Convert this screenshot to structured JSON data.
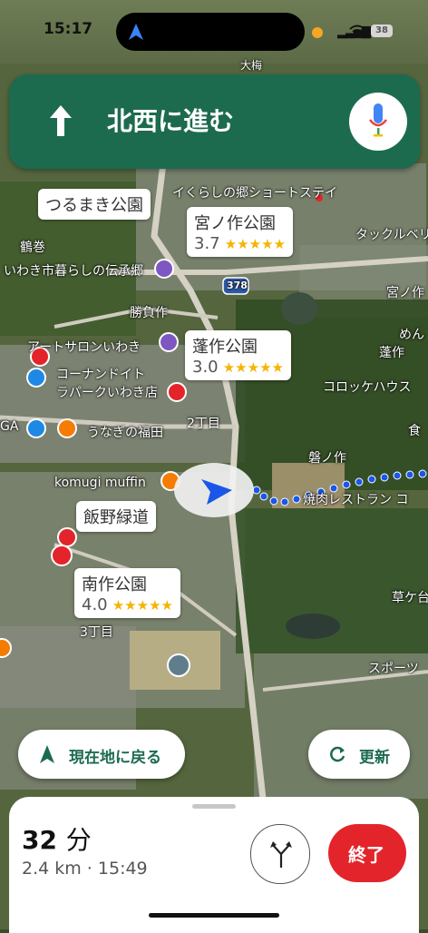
{
  "status_bar": {
    "time": "15:17",
    "battery": "38"
  },
  "navigation": {
    "instruction": "北西に進む"
  },
  "map_labels": {
    "tsurumaki_park": "つるまき公園",
    "iwaki_short_stay": "イくらしの郷ショートステイ",
    "tsurumaki_area": "鶴巻",
    "tradition_village": "いわき市暮らしの伝承郷",
    "katsuzaku": "勝負作",
    "art_salon": "アートサロンいわき",
    "konan": "コーナンドイト",
    "rapark": "ラパークいわき店",
    "unagi": "うなぎの福田",
    "komugi": "komugi muffin",
    "itchome_2": "2丁目",
    "itchome_3": "3丁目",
    "iwanosaku": "磐ノ作",
    "yakiniku": "焼肉レストラン コ",
    "croquette": "コロッケハウス",
    "takkuru": "タックルベリ",
    "miyanosaku_top": "宮ノ作",
    "men": "めん",
    "yomogisaku": "蓬作",
    "kusakizaki": "草ケ台",
    "sports": "スポーツ",
    "ga": "GA",
    "road_378": "378",
    "shoku": "食",
    "daiho": "大梅"
  },
  "place_cards": [
    {
      "name": "宮ノ作公園",
      "rating": "3.7",
      "stars": "★★★★★"
    },
    {
      "name": "蓬作公園",
      "rating": "3.0",
      "stars": "★★★★★"
    },
    {
      "name": "飯野緑道"
    },
    {
      "name": "南作公園",
      "rating": "4.0",
      "stars": "★★★★★"
    }
  ],
  "buttons": {
    "recenter": "現在地に戻る",
    "refresh": "更新",
    "end": "終了"
  },
  "trip": {
    "minutes": "32",
    "unit": "分",
    "details": "2.4 km · 15:49"
  },
  "colors": {
    "nav_green": "#1d6b4f",
    "end_red": "#e3242b",
    "route_blue": "#1a57e8",
    "star_gold": "#f4b400"
  }
}
